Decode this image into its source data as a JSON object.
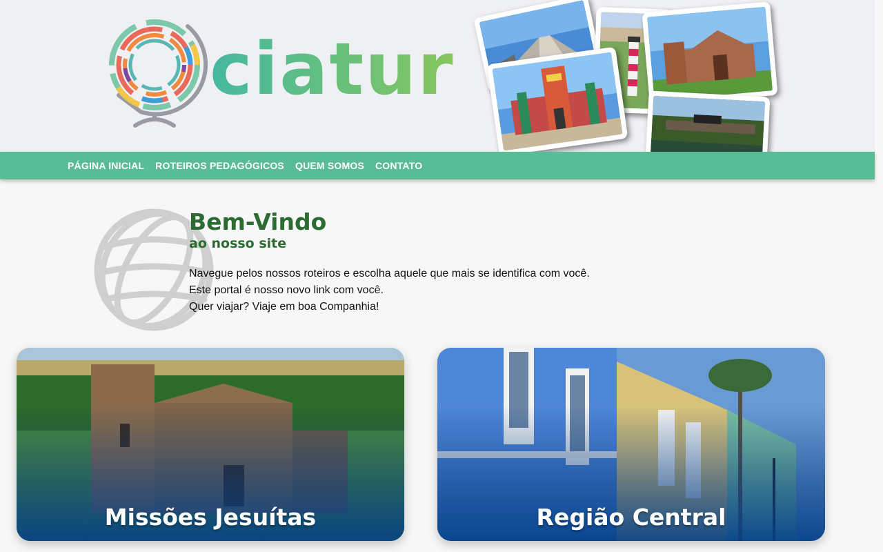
{
  "site": {
    "logo_text": "ciatur",
    "logo_alt": "ciatur logo"
  },
  "nav": {
    "items": [
      {
        "label": "PÁGINA INICIAL"
      },
      {
        "label": "ROTEIROS PEDAGÓGICOS"
      },
      {
        "label": "QUEM SOMOS"
      },
      {
        "label": "CONTATO"
      }
    ]
  },
  "welcome": {
    "title": "Bem-Vindo",
    "subtitle": "ao nosso site",
    "lines": [
      "Navegue pelos nossos roteiros e escolha aquele que mais se identifica com você.",
      "Este portal é nosso novo link com você.",
      "Quer viajar? Viaje em boa Companhia!"
    ]
  },
  "cards": [
    {
      "title": "Missões Jesuítas"
    },
    {
      "title": "Região Central"
    }
  ],
  "colors": {
    "header_bg": "#eff0f4",
    "nav_bg": "#58bd97",
    "heading_green": "#2c6b32",
    "card_overlay_blue": "#04408a",
    "logo_gradient_start": "#45b8a0",
    "logo_gradient_end": "#86c65c"
  },
  "icons": {
    "logo": "globe-logo-icon",
    "welcome": "wireframe-globe-icon"
  }
}
